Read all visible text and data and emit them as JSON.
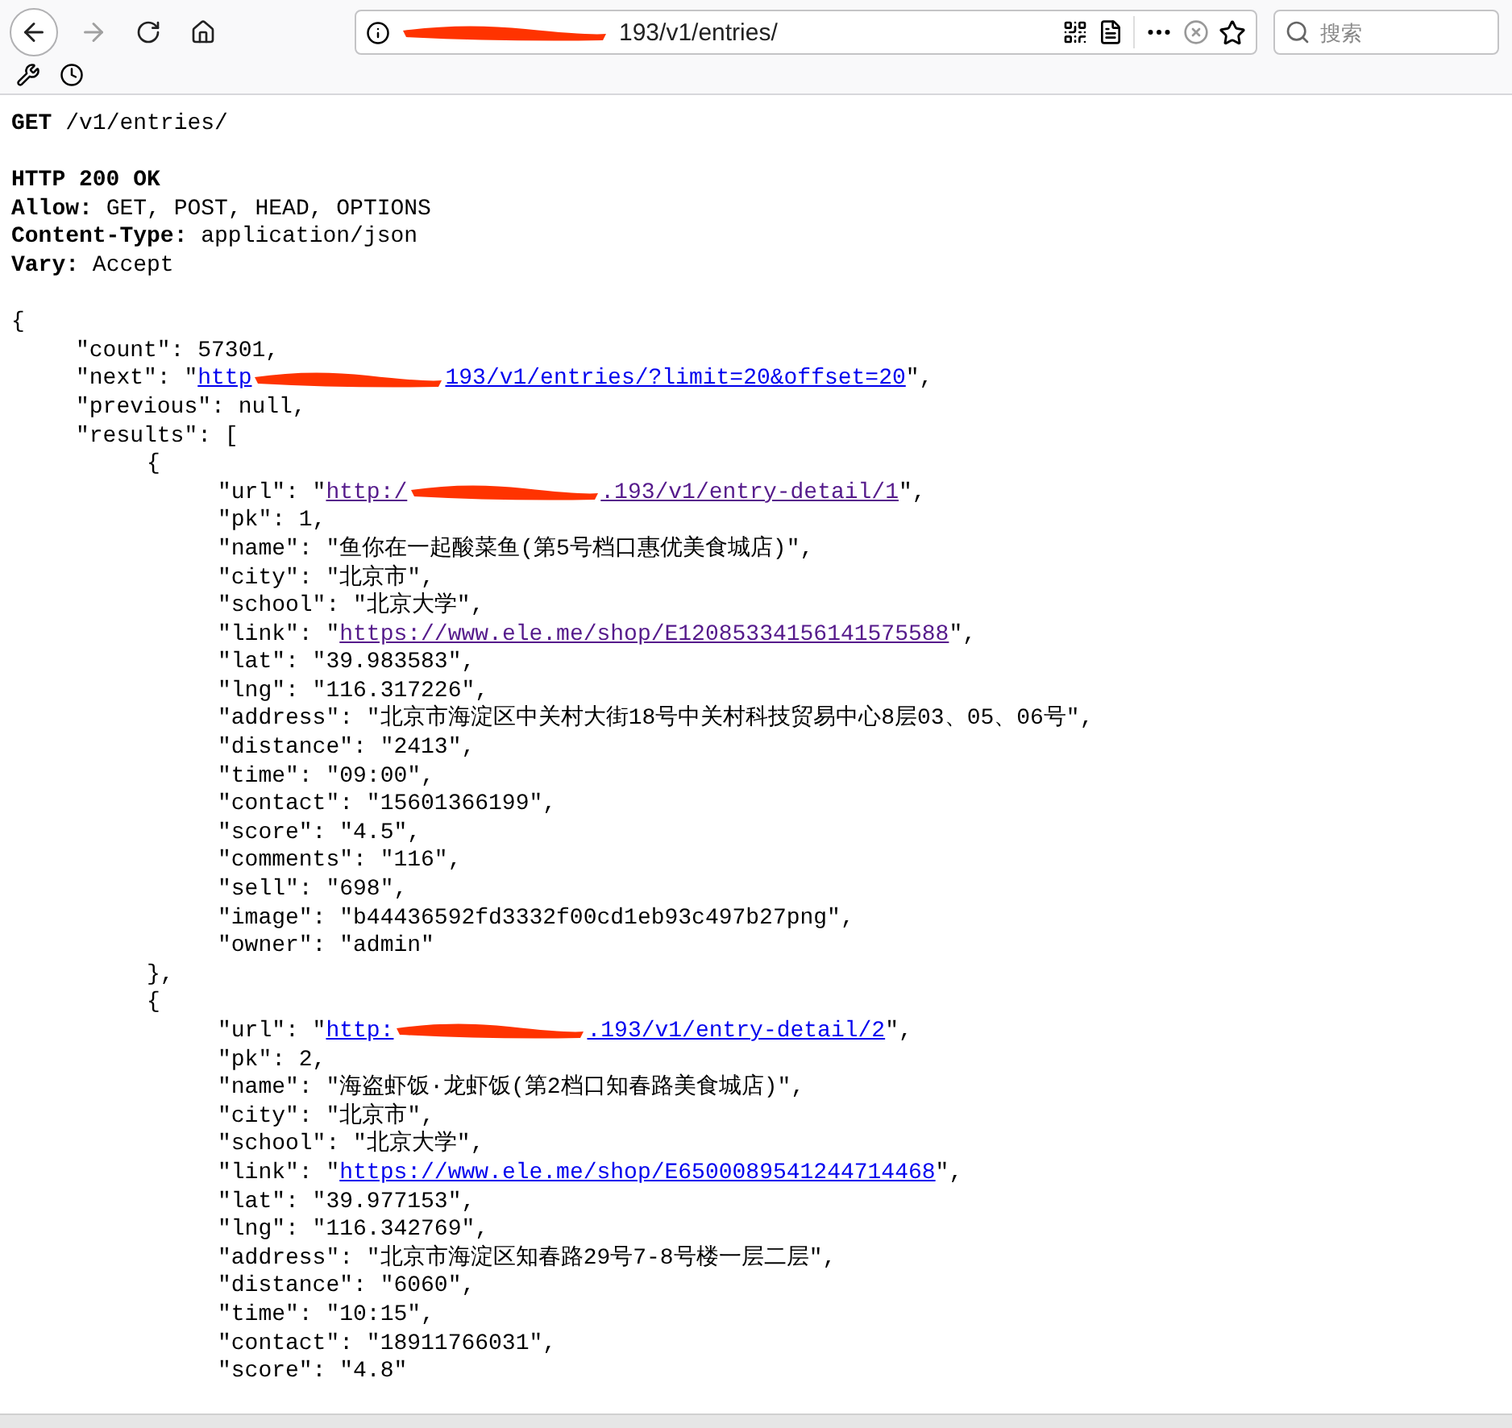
{
  "browser": {
    "address": {
      "text": "193/v1/entries/",
      "redacted": true
    },
    "search": {
      "placeholder": "搜索"
    },
    "forward_disabled": true
  },
  "request": {
    "method": "GET",
    "path": "/v1/entries/"
  },
  "response": {
    "status": "HTTP 200 OK",
    "headers": [
      {
        "name": "Allow:",
        "value": "GET, POST, HEAD, OPTIONS"
      },
      {
        "name": "Content-Type:",
        "value": "application/json"
      },
      {
        "name": "Vary:",
        "value": "Accept"
      }
    ]
  },
  "body": {
    "open": "{",
    "lines": [
      {
        "kind": "text",
        "text": "\"count\": 57301,"
      },
      {
        "kind": "link",
        "pre": "\"next\": \"",
        "link": {
          "start": "http",
          "end": "193/v1/entries/?limit=20&offset=20",
          "visited": false
        },
        "post": "\","
      },
      {
        "kind": "text",
        "text": "\"previous\": null,"
      },
      {
        "kind": "text",
        "text": "\"results\": [",
        "children": [
          {
            "kind": "text",
            "text": "{",
            "children": [
              {
                "kind": "link",
                "pre": "\"url\": \"",
                "link": {
                  "start": "http:/",
                  "end": ".193/v1/entry-detail/1",
                  "visited": true
                },
                "post": "\","
              },
              {
                "kind": "text",
                "text": "\"pk\": 1,"
              },
              {
                "kind": "text",
                "text": "\"name\": \"鱼你在一起酸菜鱼(第5号档口惠优美食城店)\","
              },
              {
                "kind": "text",
                "text": "\"city\": \"北京市\","
              },
              {
                "kind": "text",
                "text": "\"school\": \"北京大学\","
              },
              {
                "kind": "link",
                "pre": "\"link\": \"",
                "link": {
                  "start": "https://www.ele.me/shop/E12085334156141575588",
                  "visited": true
                },
                "post": "\","
              },
              {
                "kind": "text",
                "text": "\"lat\": \"39.983583\","
              },
              {
                "kind": "text",
                "text": "\"lng\": \"116.317226\","
              },
              {
                "kind": "text",
                "text": "\"address\": \"北京市海淀区中关村大街18号中关村科技贸易中心8层03、05、06号\","
              },
              {
                "kind": "text",
                "text": "\"distance\": \"2413\","
              },
              {
                "kind": "text",
                "text": "\"time\": \"09:00\","
              },
              {
                "kind": "text",
                "text": "\"contact\": \"15601366199\","
              },
              {
                "kind": "text",
                "text": "\"score\": \"4.5\","
              },
              {
                "kind": "text",
                "text": "\"comments\": \"116\","
              },
              {
                "kind": "text",
                "text": "\"sell\": \"698\","
              },
              {
                "kind": "text",
                "text": "\"image\": \"b44436592fd3332f00cd1eb93c497b27png\","
              },
              {
                "kind": "text",
                "text": "\"owner\": \"admin\""
              }
            ]
          },
          {
            "kind": "text",
            "text": "},"
          },
          {
            "kind": "text",
            "text": "{",
            "children": [
              {
                "kind": "link",
                "pre": "\"url\": \"",
                "link": {
                  "start": "http:",
                  "end": ".193/v1/entry-detail/2",
                  "visited": false
                },
                "post": "\","
              },
              {
                "kind": "text",
                "text": "\"pk\": 2,"
              },
              {
                "kind": "text",
                "text": "\"name\": \"海盗虾饭·龙虾饭(第2档口知春路美食城店)\","
              },
              {
                "kind": "text",
                "text": "\"city\": \"北京市\","
              },
              {
                "kind": "text",
                "text": "\"school\": \"北京大学\","
              },
              {
                "kind": "link",
                "pre": "\"link\": \"",
                "link": {
                  "start": "https://www.ele.me/shop/E6500089541244714468",
                  "visited": false
                },
                "post": "\","
              },
              {
                "kind": "text",
                "text": "\"lat\": \"39.977153\","
              },
              {
                "kind": "text",
                "text": "\"lng\": \"116.342769\","
              },
              {
                "kind": "text",
                "text": "\"address\": \"北京市海淀区知春路29号7-8号楼一层二层\","
              },
              {
                "kind": "text",
                "text": "\"distance\": \"6060\","
              },
              {
                "kind": "text",
                "text": "\"time\": \"10:15\","
              },
              {
                "kind": "text",
                "text": "\"contact\": \"18911766031\","
              },
              {
                "kind": "text",
                "text": "\"score\": \"4.8\""
              }
            ]
          }
        ]
      }
    ]
  }
}
